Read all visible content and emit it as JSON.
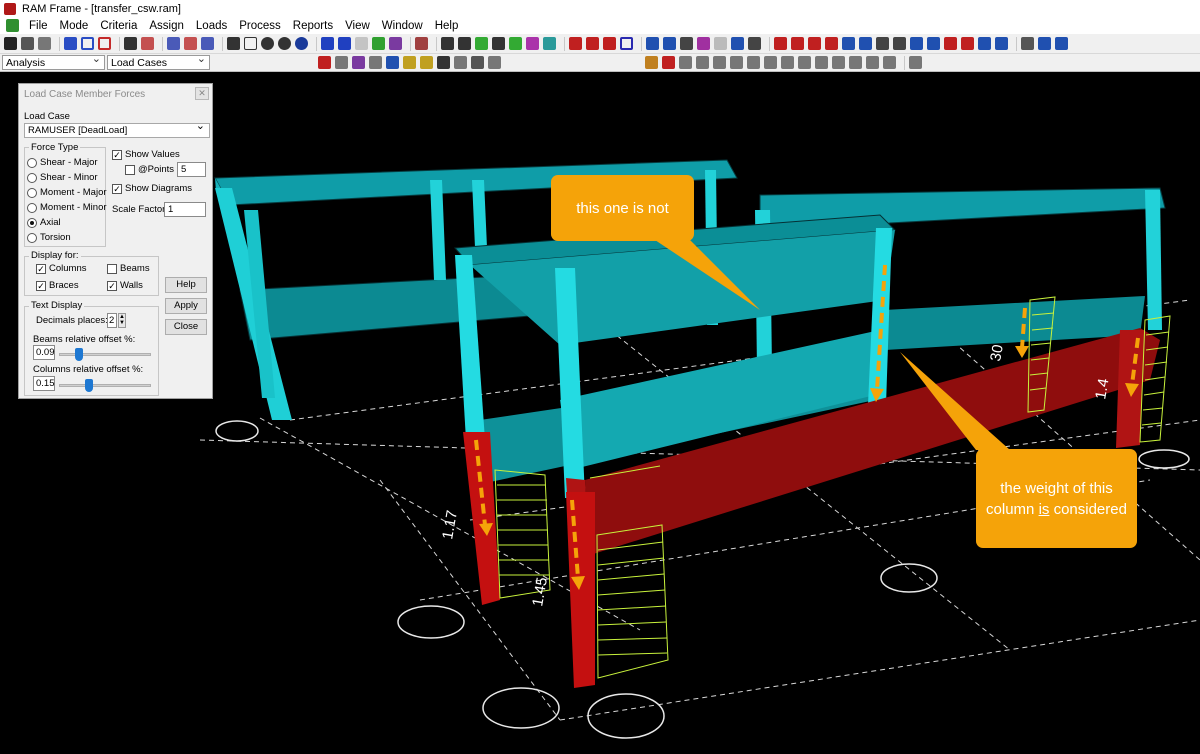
{
  "window": {
    "title": "RAM Frame - [transfer_csw.ram]"
  },
  "menu": [
    "File",
    "Mode",
    "Criteria",
    "Assign",
    "Loads",
    "Process",
    "Reports",
    "View",
    "Window",
    "Help"
  ],
  "toolbar": {
    "mode_combo": "Analysis",
    "loadcases_combo": "Load Cases"
  },
  "dialog": {
    "title": "Load Case Member Forces",
    "load_case_label": "Load Case",
    "load_case_value": "RAMUSER [DeadLoad]",
    "force_type_label": "Force Type",
    "force_types": [
      "Shear - Major",
      "Shear - Minor",
      "Moment - Major",
      "Moment - Minor",
      "Axial",
      "Torsion"
    ],
    "show_values": "Show Values",
    "points_label": "@Points :",
    "points_value": "5",
    "show_diagrams": "Show Diagrams",
    "scale_factor_label": "Scale Factor:",
    "scale_factor_value": "1",
    "display_for_label": "Display for:",
    "display_for": {
      "columns": "Columns",
      "beams": "Beams",
      "braces": "Braces",
      "walls": "Walls"
    },
    "help": "Help",
    "apply": "Apply",
    "close": "Close",
    "text_display_label": "Text Display",
    "decimals_label": "Decimals places:",
    "decimals_value": "2",
    "beams_offset_label": "Beams relative offset %:",
    "beams_offset_value": "0.09",
    "columns_offset_label": "Columns relative offset %:",
    "columns_offset_value": "0.15"
  },
  "model_labels": {
    "v1": "1.17",
    "v2": "1.45",
    "v3": "30",
    "v4": "1.4"
  },
  "callouts": {
    "top": "this one is not",
    "bottom_pre": "the weight of this column ",
    "bottom_emph": "is",
    "bottom_post": " considered"
  },
  "colors": {
    "accent": "#f5a309",
    "member": "#1fbcbc",
    "transfer": "#a30f0f",
    "diagram": "#c8f23c"
  }
}
